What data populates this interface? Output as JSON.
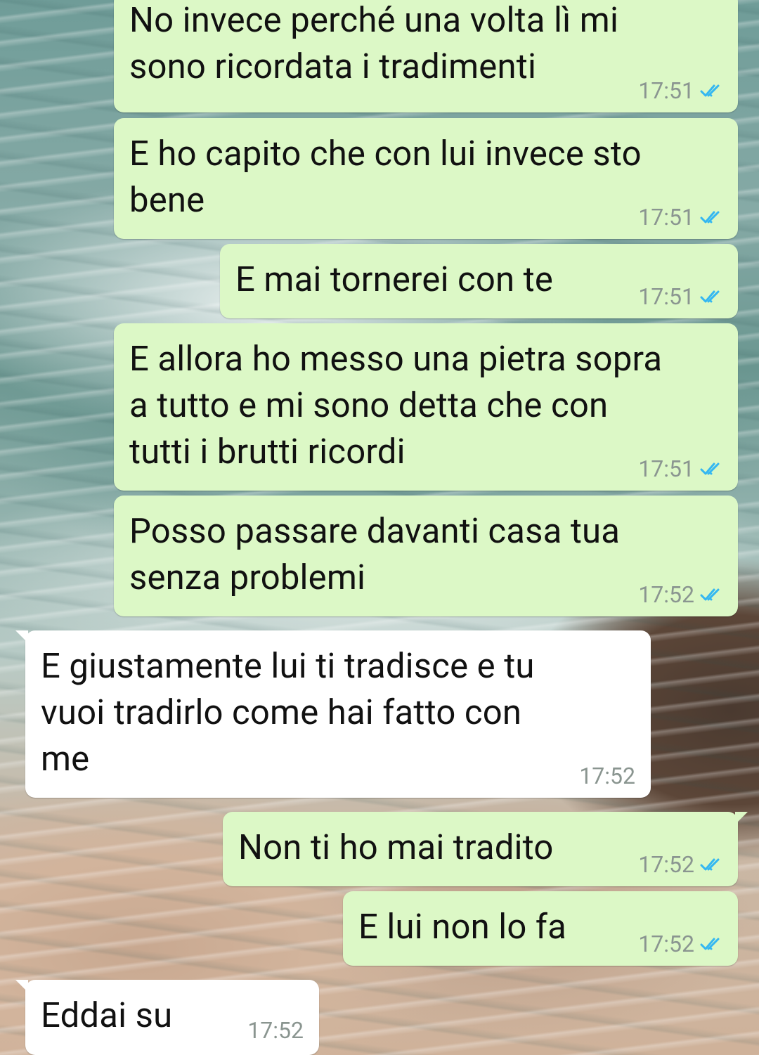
{
  "messages": [
    {
      "direction": "out",
      "text": "No invece perché una volta lì mi\nsono ricordata i tradimenti",
      "time": "17:51",
      "status": "read"
    },
    {
      "direction": "out",
      "text": "E ho capito che con lui invece sto\nbene",
      "time": "17:51",
      "status": "read"
    },
    {
      "direction": "out",
      "text": "E mai tornerei con te",
      "time": "17:51",
      "status": "read"
    },
    {
      "direction": "out",
      "text": "E allora ho messo una pietra sopra\na tutto e mi sono detta che con\ntutti i brutti ricordi",
      "time": "17:51",
      "status": "read"
    },
    {
      "direction": "out",
      "text": "Posso passare davanti casa tua\nsenza problemi",
      "time": "17:52",
      "status": "read"
    },
    {
      "direction": "in",
      "text": "E giustamente lui ti tradisce e tu\nvuoi tradirlo come hai fatto con\nme",
      "time": "17:52"
    },
    {
      "direction": "out",
      "text": "Non ti ho mai tradito",
      "time": "17:52",
      "status": "read"
    },
    {
      "direction": "out",
      "text": "E lui non lo fa",
      "time": "17:52",
      "status": "read"
    },
    {
      "direction": "in",
      "text": "Eddai su",
      "time": "17:52"
    }
  ],
  "colors": {
    "outgoing_bubble": "#dcf8c6",
    "incoming_bubble": "#ffffff",
    "timestamp": "#8a9590",
    "read_ticks": "#34b7f1"
  },
  "icons": {
    "read_status": "double-check-icon"
  }
}
